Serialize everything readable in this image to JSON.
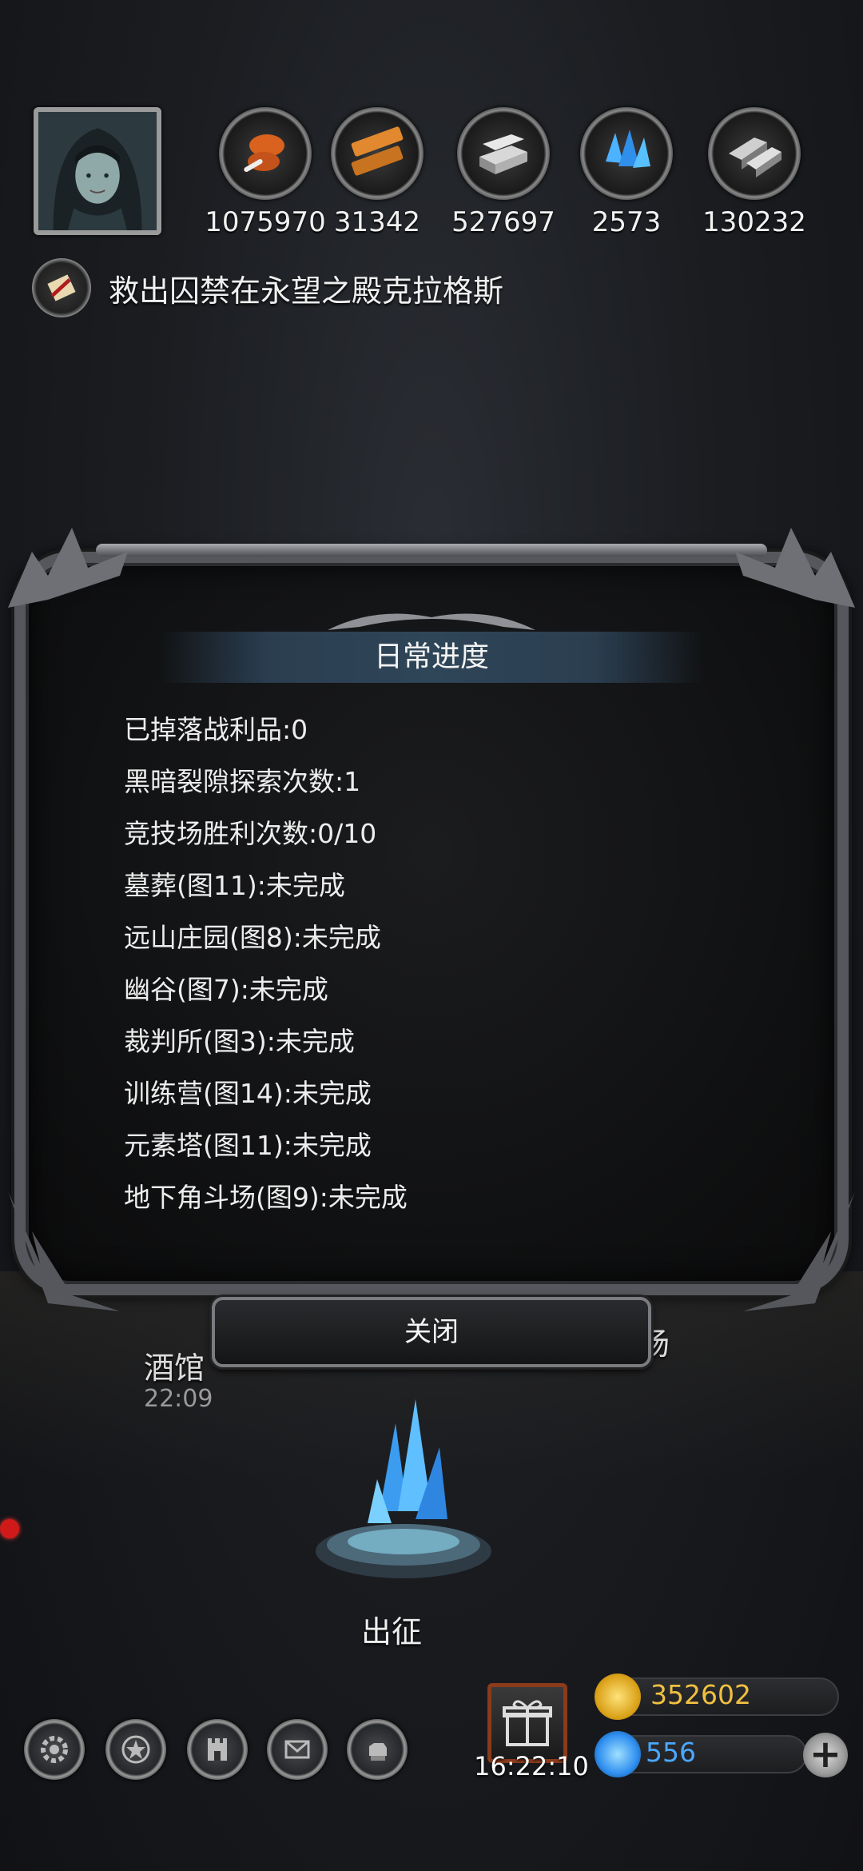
{
  "resources": [
    {
      "icon": "meat-icon",
      "value": "1075970"
    },
    {
      "icon": "wood-icon",
      "value": "31342"
    },
    {
      "icon": "iron-ingot-icon",
      "value": "527697"
    },
    {
      "icon": "crystal-icon",
      "value": "2573"
    },
    {
      "icon": "metal-bars-icon",
      "value": "130232"
    }
  ],
  "quest": {
    "text": "救出囚禁在永望之殿克拉格斯"
  },
  "background": {
    "tavern_label": "酒馆",
    "tavern_timer": "22:09",
    "right_label_fragment": "场",
    "sortie_label": "出征"
  },
  "dialog": {
    "title": "日常进度",
    "items": [
      "已掉落战利品:0",
      "黑暗裂隙探索次数:1",
      "竞技场胜利次数:0/10",
      "墓葬(图11):未完成",
      "远山庄园(图8):未完成",
      "幽谷(图7):未完成",
      "裁判所(图3):未完成",
      "训练营(图14):未完成",
      "元素塔(图11):未完成",
      "地下角斗场(图9):未完成"
    ],
    "close_label": "关闭"
  },
  "bottom": {
    "menu_icons": [
      "gear-icon",
      "star-badge-icon",
      "castle-banner-icon",
      "mail-icon",
      "gauntlet-icon"
    ],
    "gift_timer": "16:22:10",
    "gold_value": "352602",
    "gem_value": "556",
    "colors": {
      "gold": "#f0c040",
      "gem": "#4aa8ff"
    }
  }
}
